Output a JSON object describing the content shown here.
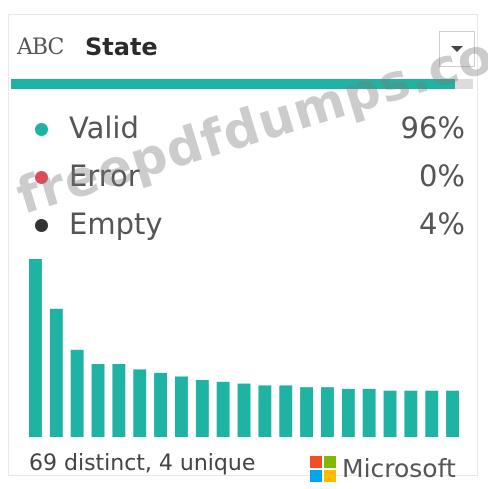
{
  "column": {
    "type_icon_main": "ABC",
    "type_icon_sub": "C",
    "title": "State"
  },
  "quality": {
    "valid_fraction": 0.96,
    "colors": {
      "valid": "#1fb3a3",
      "error": "#e04a5a",
      "empty": "#333333",
      "track": "#dcdcdc"
    },
    "rows": [
      {
        "label": "Valid",
        "value": "96%"
      },
      {
        "label": "Error",
        "value": "0%"
      },
      {
        "label": "Empty",
        "value": "4%"
      }
    ]
  },
  "distribution": {
    "bar_color": "#1fb3a3",
    "relative_heights": [
      1.0,
      0.72,
      0.49,
      0.41,
      0.41,
      0.38,
      0.36,
      0.34,
      0.32,
      0.31,
      0.3,
      0.29,
      0.29,
      0.28,
      0.28,
      0.27,
      0.27,
      0.26,
      0.26,
      0.26,
      0.26
    ]
  },
  "footer": {
    "summary": "69 distinct, 4 unique"
  },
  "watermark": {
    "text": "freepdfdumps.com"
  },
  "brand": {
    "text": "Microsoft"
  }
}
